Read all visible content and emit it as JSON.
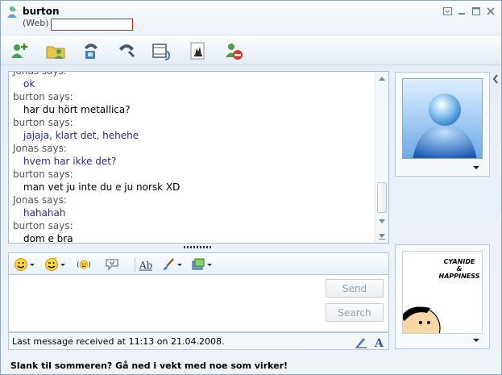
{
  "window": {
    "contact_name": "burton",
    "contact_status": "(Web)",
    "personal_message": ""
  },
  "toolbar": {
    "buttons": [
      {
        "name": "invite-icon"
      },
      {
        "name": "send-files-icon"
      },
      {
        "name": "video-call-icon"
      },
      {
        "name": "call-icon"
      },
      {
        "name": "activities-icon"
      },
      {
        "name": "games-icon"
      },
      {
        "name": "block-icon"
      }
    ]
  },
  "conversation": {
    "lines": [
      {
        "type": "says",
        "text": "Jonas says:"
      },
      {
        "type": "msg",
        "text": "ok",
        "color": "#2a2a8c"
      },
      {
        "type": "says",
        "text": "burton says:"
      },
      {
        "type": "msg",
        "text": "har du hört metallica?",
        "color": "#000000"
      },
      {
        "type": "says",
        "text": "burton says:"
      },
      {
        "type": "msg",
        "text": "jajaja, klart det, hehehe",
        "color": "#2a2a8c"
      },
      {
        "type": "says",
        "text": "Jonas says:"
      },
      {
        "type": "msg",
        "text": "hvem har ikke det?",
        "color": "#2a2a8c"
      },
      {
        "type": "says",
        "text": "burton says:"
      },
      {
        "type": "msg",
        "text": "man vet ju inte du e ju norsk XD",
        "color": "#000000"
      },
      {
        "type": "says",
        "text": "Jonas says:"
      },
      {
        "type": "msg",
        "text": "hahahah",
        "color": "#2a2a8c"
      },
      {
        "type": "says",
        "text": "burton says:"
      },
      {
        "type": "msg",
        "text": "dom e bra",
        "color": "#000000"
      }
    ]
  },
  "input": {
    "send_label": "Send",
    "search_label": "Search",
    "compose_value": ""
  },
  "status": {
    "last_message": "Last message received at 11:13 on 21.04.2008."
  },
  "my_picture": {
    "caption_line1": "CYANIDE",
    "caption_line2": "&",
    "caption_line3": "HAPPINESS"
  },
  "ad": {
    "text": "Slank til sommeren? Gå ned i vekt med noe som virker!"
  },
  "colors": {
    "accent_blue": "#2a2a8c",
    "frame_border": "#b9c9da"
  }
}
